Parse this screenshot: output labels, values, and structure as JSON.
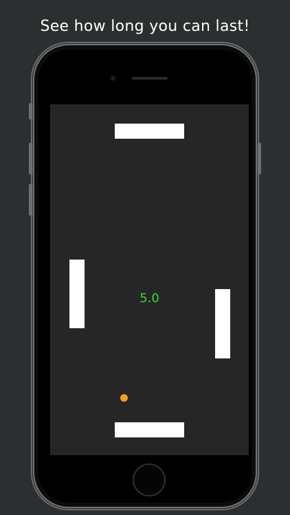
{
  "headline": "See how long you can last!",
  "game": {
    "timer": "5.0",
    "colors": {
      "background": "#2b2f30",
      "screen": "#262626",
      "paddle": "#ffffff",
      "ball": "#f0a028",
      "timer": "#35d62c"
    },
    "paddles": [
      "top",
      "bottom",
      "left",
      "right"
    ]
  }
}
